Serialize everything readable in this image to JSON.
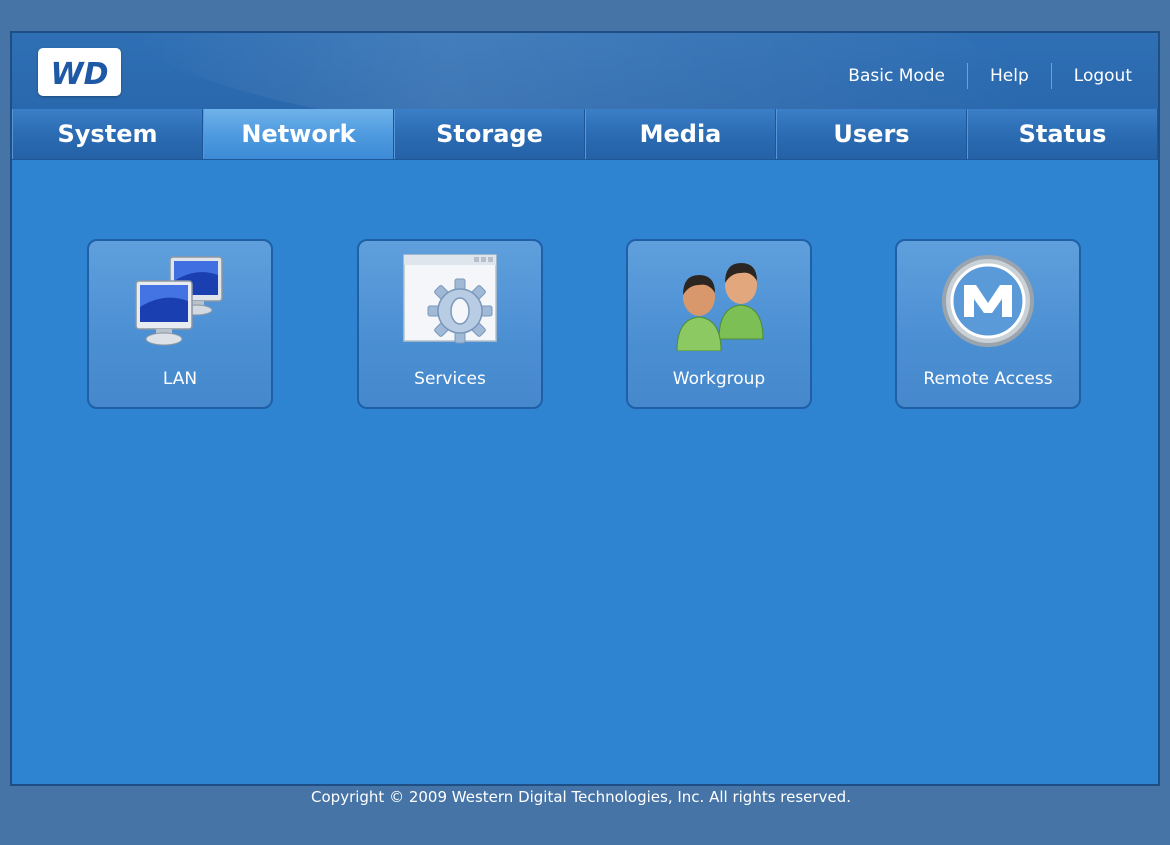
{
  "header": {
    "logo_text": "WD",
    "links": [
      "Basic Mode",
      "Help",
      "Logout"
    ]
  },
  "tabs": [
    {
      "label": "System",
      "active": false
    },
    {
      "label": "Network",
      "active": true
    },
    {
      "label": "Storage",
      "active": false
    },
    {
      "label": "Media",
      "active": false
    },
    {
      "label": "Users",
      "active": false
    },
    {
      "label": "Status",
      "active": false
    }
  ],
  "tiles": [
    {
      "label": "LAN",
      "icon": "lan-monitors-icon"
    },
    {
      "label": "Services",
      "icon": "services-gear-icon"
    },
    {
      "label": "Workgroup",
      "icon": "workgroup-users-icon"
    },
    {
      "label": "Remote Access",
      "icon": "remote-access-m-icon"
    }
  ],
  "footer": {
    "copyright": "Copyright © 2009 Western Digital Technologies, Inc. All rights reserved."
  },
  "colors": {
    "background": "#4674a7",
    "panel": "#2f84d2",
    "tab_active": "#4f9be0",
    "tab_inactive": "#2b6cb3",
    "tile": "#4b8fd3"
  }
}
